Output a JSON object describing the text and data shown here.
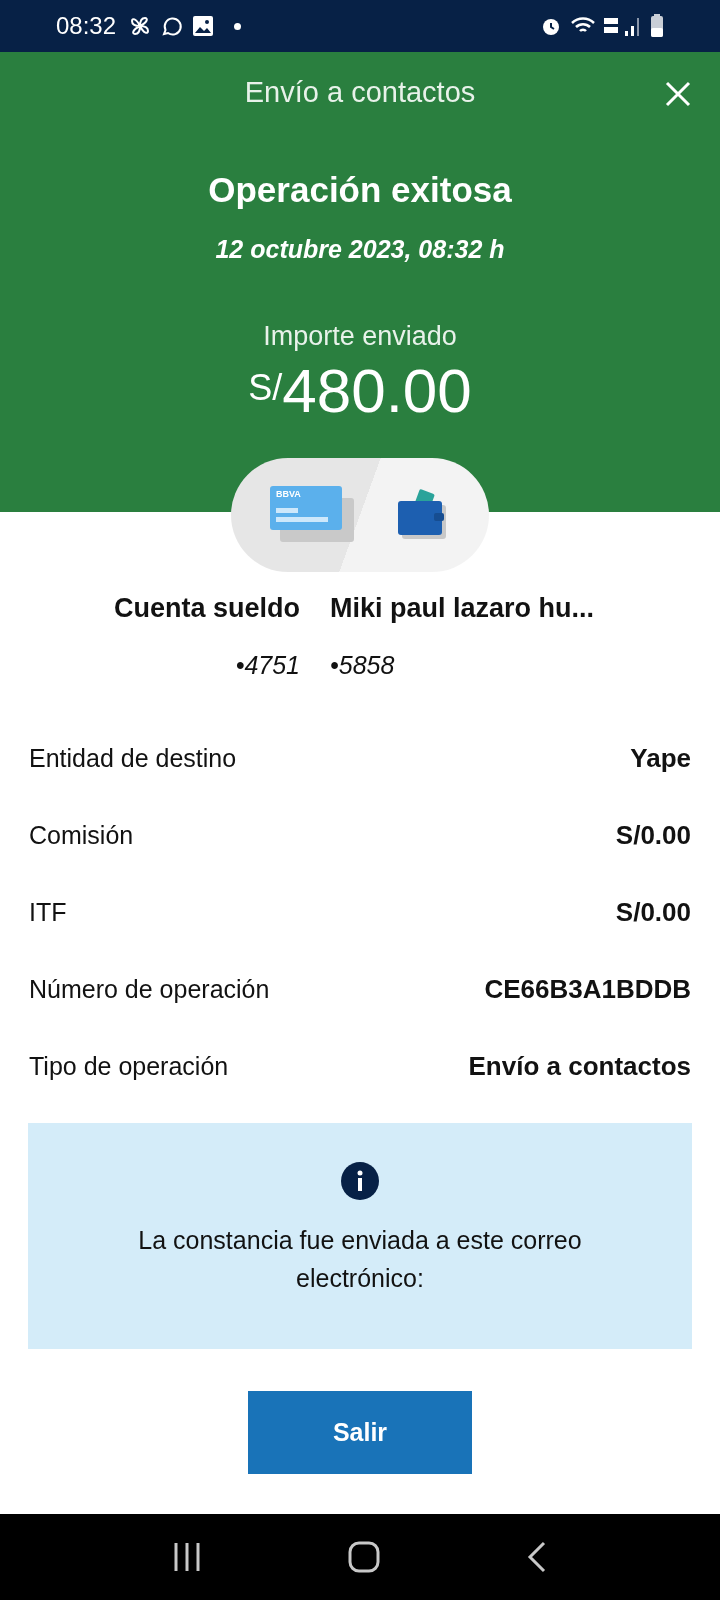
{
  "status_bar": {
    "time": "08:32"
  },
  "header": {
    "title": "Envío a contactos",
    "status": "Operación exitosa",
    "date": "12 octubre 2023, 08:32 h",
    "amount_label": "Importe enviado",
    "currency": "S/",
    "amount": "480.00"
  },
  "transfer": {
    "card_brand": "BBVA",
    "from": {
      "name": "Cuenta sueldo",
      "number": "•4751"
    },
    "to": {
      "name": "Miki paul lazaro hu...",
      "number": "•5858"
    }
  },
  "details": [
    {
      "label": "Entidad de destino",
      "value": "Yape"
    },
    {
      "label": "Comisión",
      "value": "S/0.00"
    },
    {
      "label": "ITF",
      "value": "S/0.00"
    },
    {
      "label": "Número de operación",
      "value": "CE66B3A1BDDB"
    },
    {
      "label": "Tipo de operación",
      "value": "Envío a contactos"
    }
  ],
  "info": {
    "text": "La constancia fue enviada a este correo electrónico:"
  },
  "button": "Salir"
}
